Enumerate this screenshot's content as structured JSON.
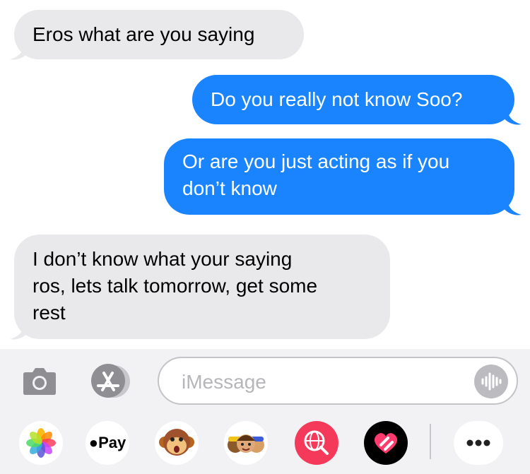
{
  "messages": [
    {
      "direction": "received",
      "text": "Eros what are you saying"
    },
    {
      "direction": "sent",
      "text": "Do you really not know Soo?"
    },
    {
      "direction": "sent",
      "lines": [
        "Or are you just acting as if you",
        "don’t know"
      ]
    },
    {
      "direction": "received",
      "lines": [
        "I don’t know what your saying",
        "ros, lets talk tomorrow, get some",
        "rest"
      ]
    }
  ],
  "composer": {
    "placeholder": "iMessage",
    "value": ""
  },
  "app_tray": {
    "apple_pay_label": "Pay",
    "items": [
      "photos-app",
      "apple-pay",
      "animoji",
      "memoji-stickers",
      "image-search",
      "digital-touch",
      "more"
    ]
  },
  "colors": {
    "sent_bubble": "#1a84ff",
    "received_bubble": "#e9e9eb",
    "composer_bg": "#f2f2f4"
  }
}
